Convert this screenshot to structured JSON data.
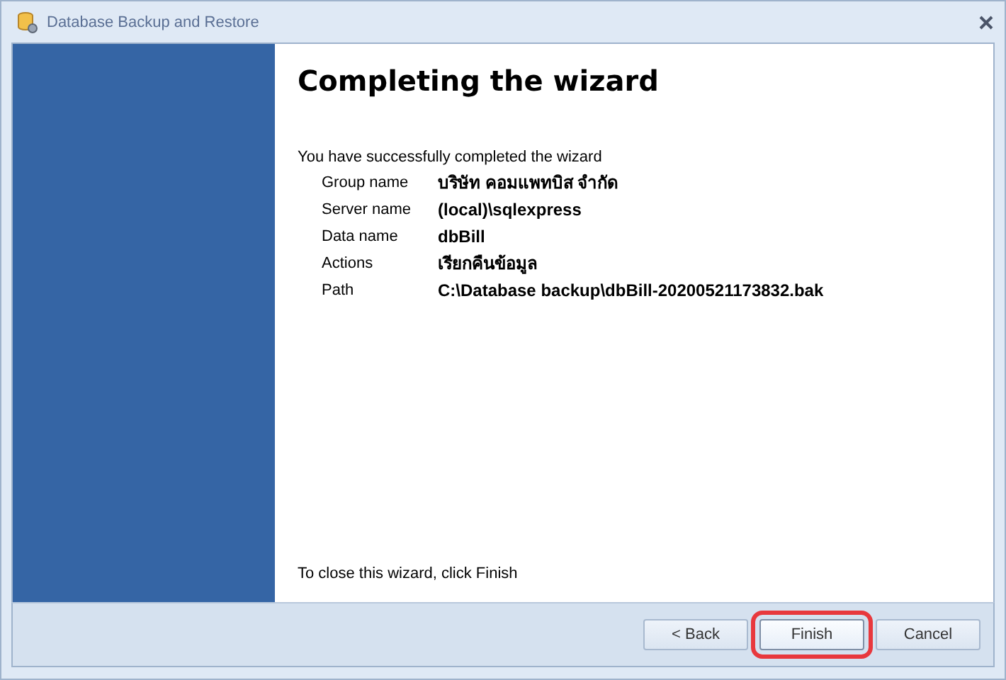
{
  "window": {
    "title": "Database Backup and Restore"
  },
  "heading": "Completing the wizard",
  "intro": "You have successfully completed the wizard",
  "summary": [
    {
      "label": "Group name",
      "value": "บริษัท คอมแพทบิส จำกัด"
    },
    {
      "label": "Server name",
      "value": "(local)\\sqlexpress"
    },
    {
      "label": "Data name",
      "value": "dbBill"
    },
    {
      "label": "Actions",
      "value": "เรียกคืนข้อมูล"
    },
    {
      "label": "Path",
      "value": "C:\\Database backup\\dbBill-20200521173832.bak"
    }
  ],
  "footer_note": "To close this wizard, click Finish",
  "buttons": [
    {
      "label": "< Back",
      "highlighted": false
    },
    {
      "label": "Finish",
      "highlighted": true
    },
    {
      "label": "Cancel",
      "highlighted": false
    }
  ]
}
